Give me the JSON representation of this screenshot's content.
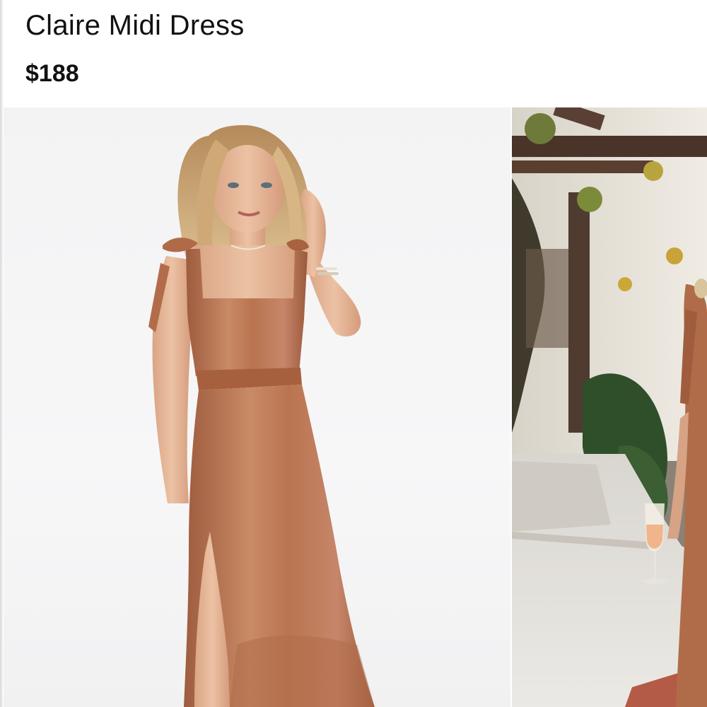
{
  "product": {
    "title": "Claire Midi Dress",
    "price": "$188"
  },
  "gallery": {
    "images": [
      {
        "alt": "",
        "subject": "model-studio-front"
      },
      {
        "alt": "",
        "subject": "model-outdoor-garden"
      }
    ]
  },
  "colors": {
    "text": "#111111",
    "dress": "#b8734f",
    "studio_bg": "#f4f4f5"
  }
}
